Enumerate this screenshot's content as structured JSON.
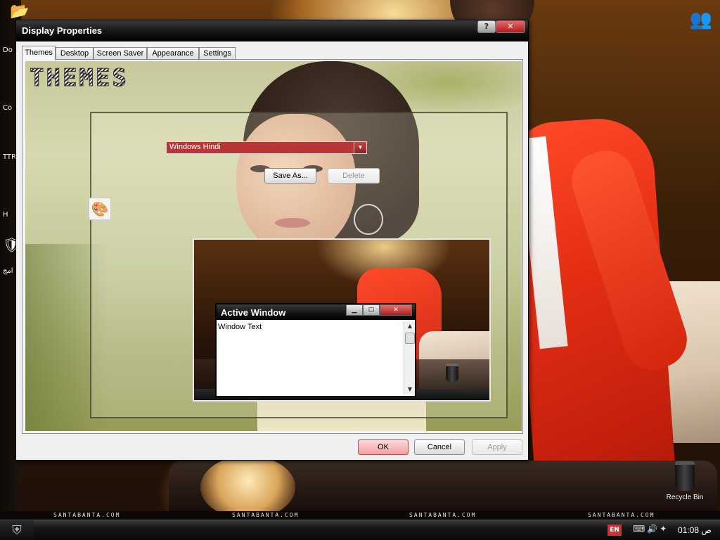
{
  "desktop": {
    "icons": [
      {
        "label": "Do"
      },
      {
        "label": "Co"
      },
      {
        "label": "TTR"
      },
      {
        "label": "H"
      },
      {
        "label": "امج"
      }
    ],
    "recycle_bin_label": "Recycle Bin",
    "watermark": "SANTABANTA.COM"
  },
  "taskbar": {
    "language": "EN",
    "clock": "01:08 ص"
  },
  "dialog": {
    "title": "Display Properties",
    "help_label": "?",
    "close_label": "✕",
    "tabs": [
      {
        "label": "Themes",
        "active": true
      },
      {
        "label": "Desktop",
        "active": false
      },
      {
        "label": "Screen Saver",
        "active": false
      },
      {
        "label": "Appearance",
        "active": false
      },
      {
        "label": "Settings",
        "active": false
      }
    ],
    "themes_heading": "THEMES",
    "theme_select": {
      "value": "Windows Hindi"
    },
    "save_as_label": "Save As...",
    "delete_label": "Delete",
    "preview": {
      "active_window_title": "Active Window",
      "window_text": "Window Text"
    },
    "ok_label": "OK",
    "cancel_label": "Cancel",
    "apply_label": "Apply"
  },
  "colors": {
    "select_bg": "#b83636",
    "ok_bg": "#f0a0a0",
    "lang_bg": "#c7343a"
  }
}
